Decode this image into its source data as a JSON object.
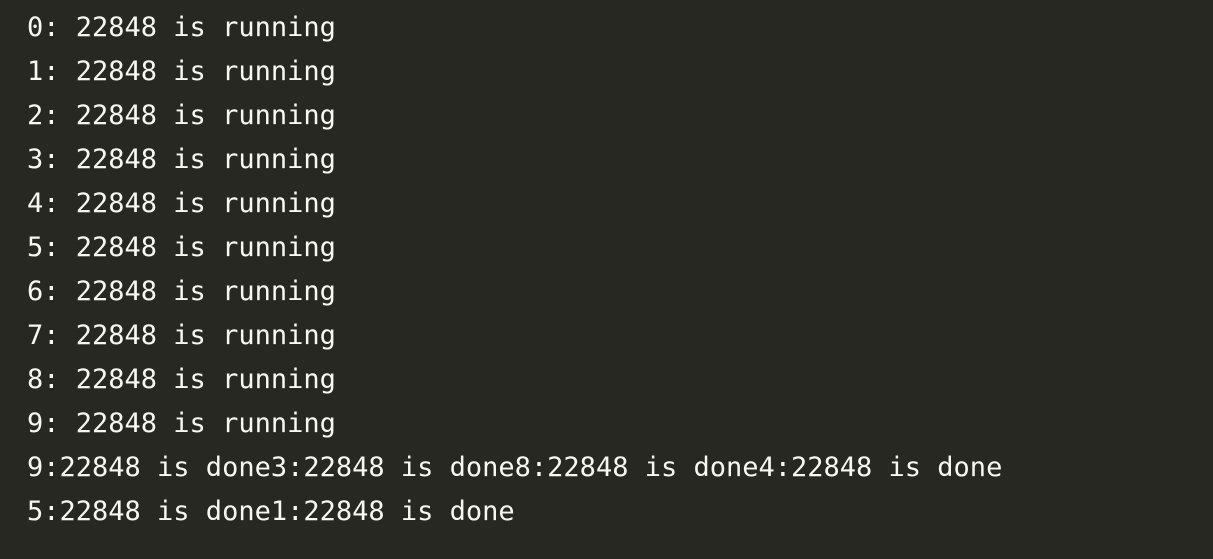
{
  "console": {
    "lines": [
      "0: 22848 is running",
      "1: 22848 is running",
      "2: 22848 is running",
      "3: 22848 is running",
      "4: 22848 is running",
      "5: 22848 is running",
      "6: 22848 is running",
      "7: 22848 is running",
      "8: 22848 is running",
      "9: 22848 is running",
      "9:22848 is done3:22848 is done8:22848 is done4:22848 is done",
      "5:22848 is done1:22848 is done"
    ]
  },
  "colors": {
    "background": "#272822",
    "text": "#f8f8f2"
  }
}
